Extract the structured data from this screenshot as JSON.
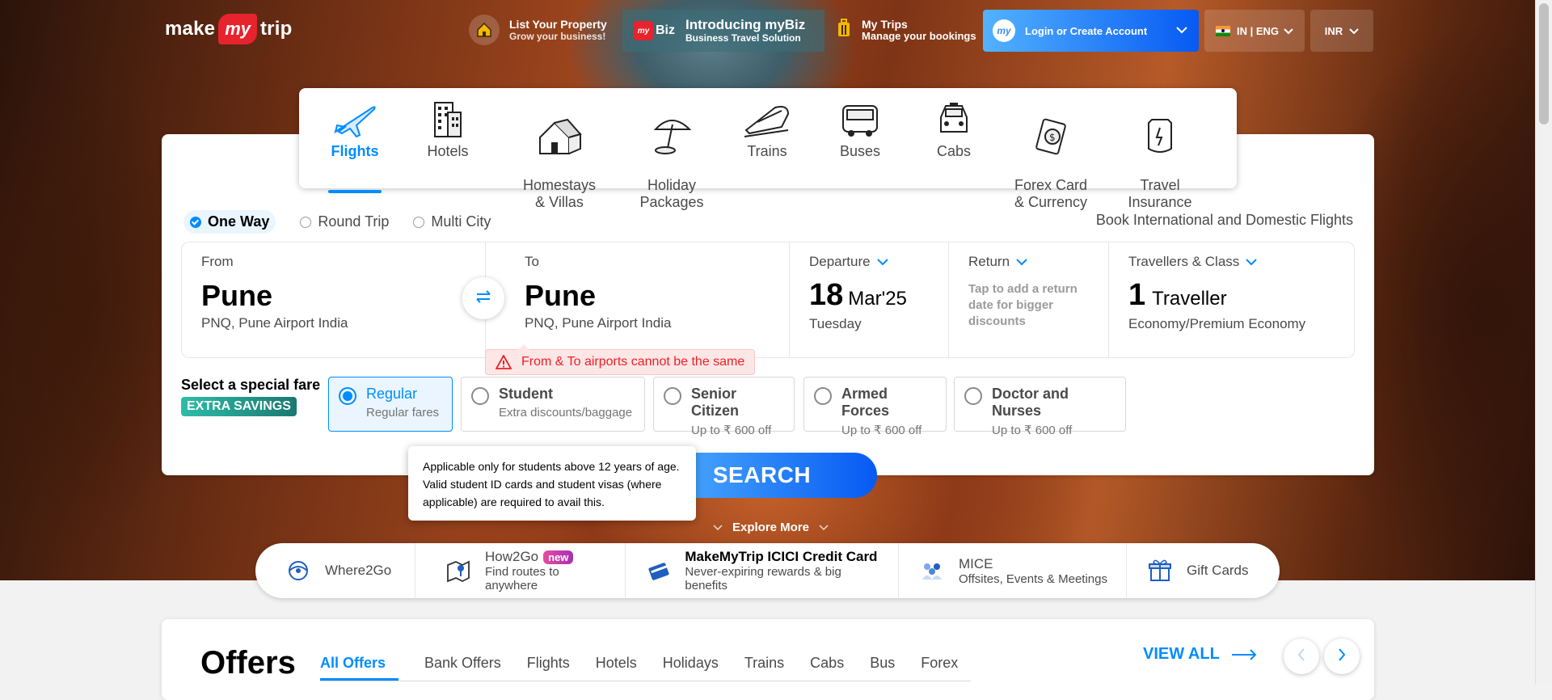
{
  "header": {
    "logo": {
      "part1": "make",
      "part2": "my",
      "part3": "trip"
    },
    "list_property": {
      "title": "List Your Property",
      "subtitle": "Grow your business!"
    },
    "mybiz": {
      "badge": "Biz",
      "badge_prefix": "my",
      "title": "Introducing myBiz",
      "subtitle": "Business Travel Solution"
    },
    "my_trips": {
      "title": "My Trips",
      "subtitle": "Manage your bookings"
    },
    "login": {
      "avatar": "my",
      "label": "Login or Create Account"
    },
    "locale": "IN | ENG",
    "currency": "INR"
  },
  "nav": {
    "items": [
      {
        "label": "Flights",
        "icon": "plane-icon",
        "active": true
      },
      {
        "label": "Hotels",
        "icon": "hotel-icon"
      },
      {
        "label": "Homestays\n& Villas",
        "icon": "homestay-icon"
      },
      {
        "label": "Holiday\nPackages",
        "icon": "umbrella-icon"
      },
      {
        "label": "Trains",
        "icon": "train-icon"
      },
      {
        "label": "Buses",
        "icon": "bus-icon"
      },
      {
        "label": "Cabs",
        "icon": "cab-icon"
      },
      {
        "label": "Forex Card\n& Currency",
        "icon": "forex-icon"
      },
      {
        "label": "Travel\nInsurance",
        "icon": "insurance-icon"
      }
    ]
  },
  "trip_types": [
    "One Way",
    "Round Trip",
    "Multi City"
  ],
  "trip_type_selected": "One Way",
  "intl_text": "Book International and Domestic Flights",
  "search": {
    "from": {
      "label": "From",
      "city": "Pune",
      "airport": "PNQ, Pune Airport India"
    },
    "to": {
      "label": "To",
      "city": "Pune",
      "airport": "PNQ, Pune Airport India"
    },
    "departure": {
      "label": "Departure",
      "day": "18",
      "month": "Mar'25",
      "weekday": "Tuesday"
    },
    "return": {
      "label": "Return",
      "hint": "Tap to add a return date for bigger discounts"
    },
    "travellers": {
      "label": "Travellers & Class",
      "count": "1",
      "unit": "Traveller",
      "class": "Economy/Premium Economy"
    }
  },
  "error": "From & To airports cannot be the same",
  "special_fare": {
    "title": "Select a special fare",
    "badge": "EXTRA SAVINGS",
    "options": [
      {
        "title": "Regular",
        "sub": "Regular fares",
        "selected": true
      },
      {
        "title": "Student",
        "sub": "Extra discounts/baggage"
      },
      {
        "title": "Senior Citizen",
        "sub": "Up to ₹ 600 off"
      },
      {
        "title": "Armed Forces",
        "sub": "Up to ₹ 600 off"
      },
      {
        "title": "Doctor and Nurses",
        "sub": "Up to ₹ 600 off"
      }
    ]
  },
  "tooltip": "Applicable only for students above 12 years of age. Valid student ID cards and student visas (where applicable) are required to avail this.",
  "search_button": "SEARCH",
  "explore_more": "Explore More",
  "promo": [
    {
      "title": "Where2Go",
      "icon": "where2go-icon"
    },
    {
      "title": "How2Go",
      "badge": "new",
      "sub": "Find routes to anywhere",
      "icon": "map-route-icon"
    },
    {
      "title": "MakeMyTrip ICICI Credit Card",
      "sub": "Never-expiring rewards & big benefits",
      "icon": "credit-card-icon"
    },
    {
      "title": "MICE",
      "sub": "Offsites, Events & Meetings",
      "icon": "mice-icon"
    },
    {
      "title": "Gift Cards",
      "icon": "gift-icon"
    }
  ],
  "offers": {
    "title": "Offers",
    "tabs": [
      "All Offers",
      "Bank Offers",
      "Flights",
      "Hotels",
      "Holidays",
      "Trains",
      "Cabs",
      "Bus",
      "Forex"
    ],
    "active_tab": "All Offers",
    "view_all": "VIEW ALL"
  },
  "colors": {
    "accent": "#008cff",
    "brand_red": "#e7232d",
    "error": "#eb2026",
    "savings": "#1a7971"
  }
}
